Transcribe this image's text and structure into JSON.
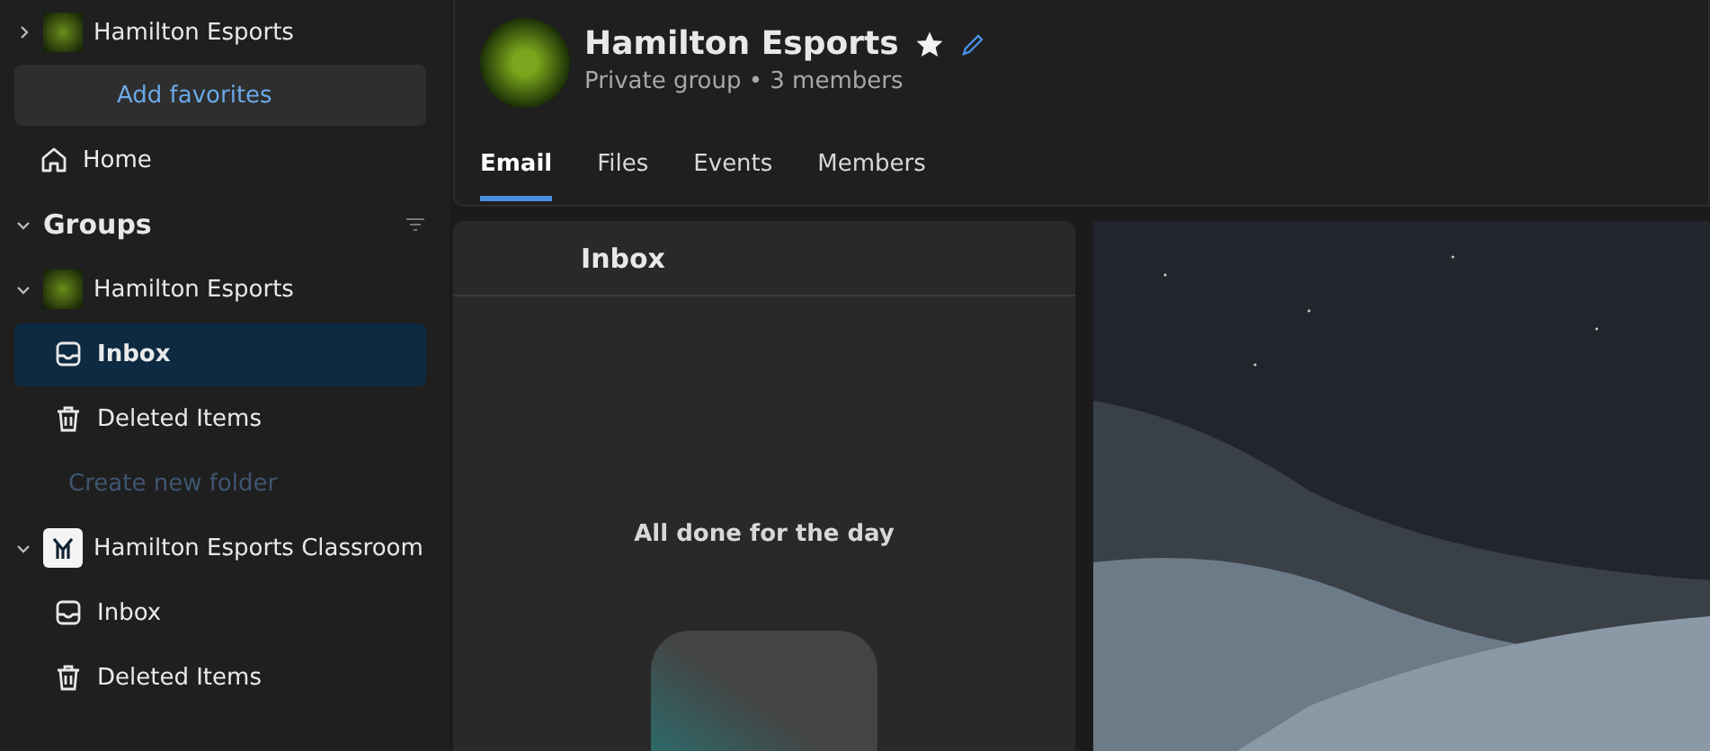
{
  "favorites": {
    "group": {
      "name": "Hamilton Esports",
      "kind": "mascot",
      "expanded": false
    },
    "add_button": "Add favorites"
  },
  "home": {
    "label": "Home"
  },
  "groups": {
    "title": "Groups",
    "expanded": true,
    "items": [
      {
        "name": "Hamilton Esports",
        "kind": "mascot",
        "expanded": true,
        "folders": [
          {
            "label": "Inbox",
            "kind": "inbox",
            "selected": true
          },
          {
            "label": "Deleted Items",
            "kind": "trash",
            "selected": false
          }
        ],
        "create_folder": "Create new folder"
      },
      {
        "name": "Hamilton Esports Classroom",
        "kind": "monogram",
        "expanded": true,
        "folders": [
          {
            "label": "Inbox",
            "kind": "inbox",
            "selected": false
          },
          {
            "label": "Deleted Items",
            "kind": "trash",
            "selected": false
          }
        ]
      }
    ]
  },
  "header": {
    "title": "Hamilton Esports",
    "favorite": true,
    "subtitle": "Private group • 3 members"
  },
  "tabs": [
    {
      "label": "Email",
      "selected": true
    },
    {
      "label": "Files",
      "selected": false
    },
    {
      "label": "Events",
      "selected": false
    },
    {
      "label": "Members",
      "selected": false
    }
  ],
  "inbox": {
    "title": "Inbox",
    "empty_message": "All done for the day"
  }
}
